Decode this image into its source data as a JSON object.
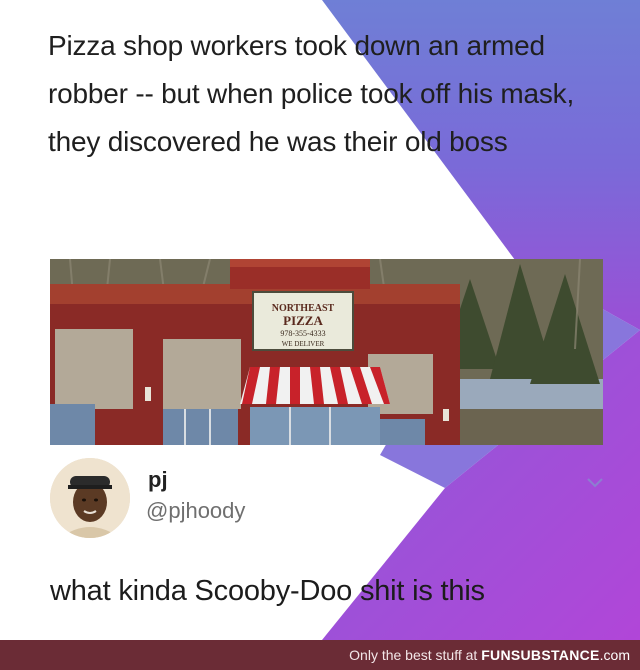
{
  "post": {
    "headline": "Pizza shop workers took down an armed robber -- but when police took off his mask, they discovered he was their old boss",
    "image": {
      "sign_line1": "NORTHEAST",
      "sign_line2": "PIZZA",
      "sign_phone": "978-355-4333",
      "sign_line3": "WE DELIVER"
    }
  },
  "reply": {
    "author_name": "pj",
    "author_handle": "@pjhoody",
    "text": "what kinda Scooby-Doo shit is this"
  },
  "footer": {
    "tagline": "Only the best stuff at ",
    "brand": "FUNSUBSTANCE",
    "dotcom": ".com"
  },
  "colors": {
    "gradient_top": "#5f7ed8",
    "gradient_bottom": "#a54bd8",
    "footer_bg": "#6b2c36"
  },
  "icons": {
    "chevron": "chevron-down-icon",
    "avatar": "avatar"
  }
}
